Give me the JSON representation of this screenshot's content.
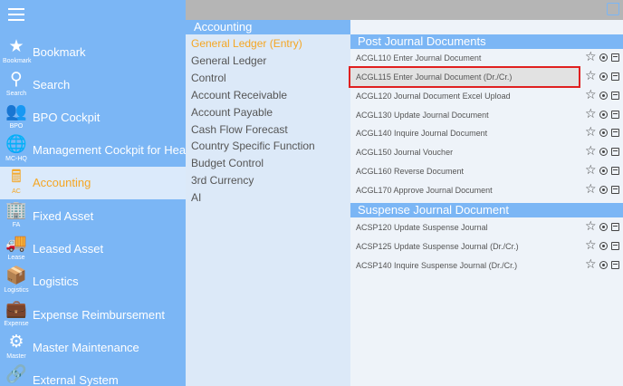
{
  "sidebar": {
    "items": [
      {
        "label": "Bookmark",
        "abbr": "Bookmark",
        "icon": "star-icon",
        "glyph": "★"
      },
      {
        "label": "Search",
        "abbr": "Search",
        "icon": "search-icon",
        "glyph": "⚲"
      },
      {
        "label": "BPO Cockpit",
        "abbr": "BPO",
        "icon": "people-icon",
        "glyph": "👥"
      },
      {
        "label": "Management Cockpit for Headquarters",
        "abbr": "MC-HQ",
        "icon": "globe-icon",
        "glyph": "🌐"
      },
      {
        "label": "Accounting",
        "abbr": "AC",
        "icon": "calculator-icon",
        "glyph": "🖩"
      },
      {
        "label": "Fixed Asset",
        "abbr": "FA",
        "icon": "building-icon",
        "glyph": "🏢"
      },
      {
        "label": "Leased Asset",
        "abbr": "Lease",
        "icon": "truck-icon",
        "glyph": "🚚"
      },
      {
        "label": "Logistics",
        "abbr": "Logistics",
        "icon": "box-icon",
        "glyph": "📦"
      },
      {
        "label": "Expense Reimbursement",
        "abbr": "Expense",
        "icon": "briefcase-icon",
        "glyph": "💼"
      },
      {
        "label": "Master Maintenance",
        "abbr": "Master",
        "icon": "gear-icon",
        "glyph": "⚙"
      },
      {
        "label": "External System",
        "abbr": "",
        "icon": "link-icon",
        "glyph": "🔗"
      }
    ]
  },
  "middle": {
    "header": "Accounting",
    "items": [
      "General Ledger (Entry)",
      "General Ledger",
      "Control",
      "Account Receivable",
      "Account Payable",
      "Cash Flow Forecast",
      "Country Specific Function",
      "Budget Control",
      "3rd Currency",
      "AI"
    ]
  },
  "right": {
    "section1": {
      "header": "Post Journal Documents",
      "rows": [
        "ACGL110 Enter Journal Document",
        "ACGL115 Enter Journal Document (Dr./Cr.)",
        "ACGL120 Journal Document Excel Upload",
        "ACGL130 Update Journal Document",
        "ACGL140 Inquire Journal Document",
        "ACGL150 Journal Voucher",
        "ACGL160 Reverse Document",
        "ACGL170 Approve Journal Document"
      ]
    },
    "section2": {
      "header": "Suspense Journal Document",
      "rows": [
        "ACSP120 Update Suspense Journal",
        "ACSP125 Update Suspense Journal (Dr./Cr.)",
        "ACSP140 Inquire Suspense Journal (Dr./Cr.)"
      ]
    }
  },
  "colors": {
    "sidebar": "#7bb6f5",
    "active": "#f5a623",
    "highlight_border": "#e02020"
  }
}
